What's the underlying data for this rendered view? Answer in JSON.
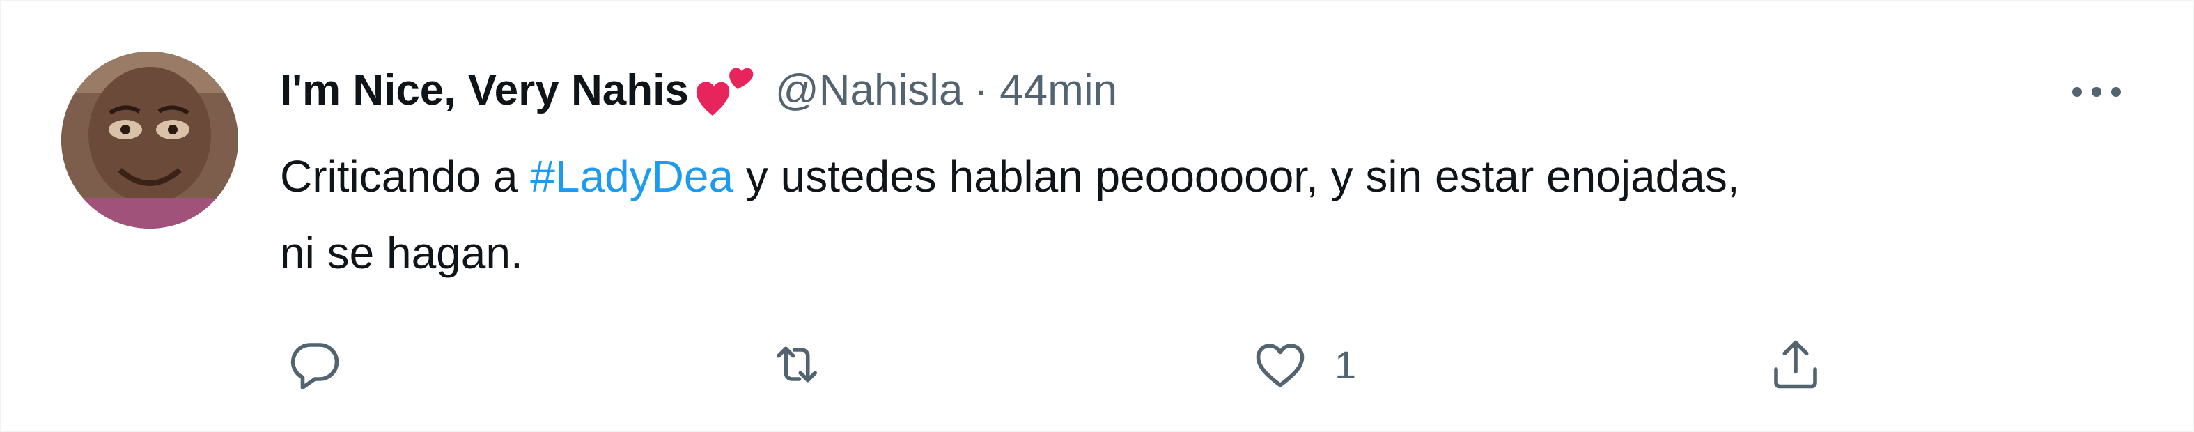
{
  "tweet": {
    "display_name": "I'm Nice, Very Nahis",
    "name_emoji": "hearts-emoji",
    "handle": "@Nahisla",
    "separator": "·",
    "time": "44min",
    "text": {
      "before_hashtag": "Criticando a ",
      "hashtag": "#LadyDea",
      "after_hashtag_line1": " y ustedes hablan peoooooor, y sin estar enojadas,",
      "line2": "ni se hagan."
    }
  },
  "actions": {
    "reply": {
      "icon": "reply-icon"
    },
    "retweet": {
      "icon": "retweet-icon"
    },
    "like": {
      "icon": "heart-icon",
      "count": "1"
    },
    "share": {
      "icon": "share-icon"
    }
  },
  "colors": {
    "hashtag": "#1d9bf0",
    "text": "#0f1419",
    "secondary": "#536471",
    "emoji_heart": "#e8245c"
  }
}
